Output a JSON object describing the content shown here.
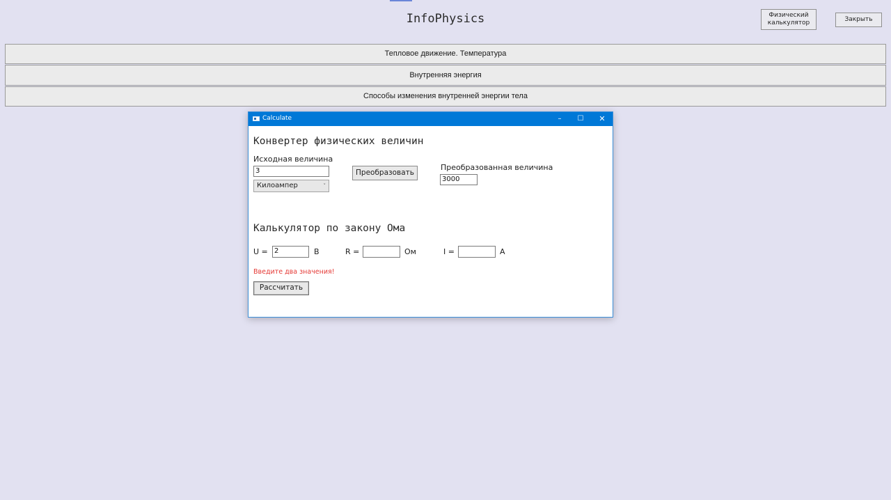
{
  "app": {
    "title": "InfoPhysics",
    "calculator_button": "Физический\nкалькулятор",
    "close_button": "Закрыть"
  },
  "topics": [
    "Тепловое движение. Температура",
    "Внутренняя энергия",
    "Способы изменения внутренней энергии тела"
  ],
  "dialog": {
    "title": "Calculate",
    "controls": {
      "minimize": "–",
      "maximize": "☐",
      "close": "✕"
    },
    "converter": {
      "title": "Конвертер физических величин",
      "source_label": "Исходная величина",
      "source_value": "3",
      "unit_selected": "Килоампер",
      "convert_button": "Преобразовать",
      "result_label": "Преобразованная величина",
      "result_value": "3000"
    },
    "ohm": {
      "title": "Калькулятор по закону Ома",
      "u_label": "U =",
      "u_value": "2",
      "u_unit": "В",
      "r_label": "R =",
      "r_value": "",
      "r_unit": "Ом",
      "i_label": "I =",
      "i_value": "",
      "i_unit": "А",
      "error": "Введите два значения!",
      "calculate_button": "Рассчитать"
    }
  },
  "colors": {
    "background": "#e2e1f1",
    "titlebar": "#0078d7",
    "error": "#e53935"
  }
}
